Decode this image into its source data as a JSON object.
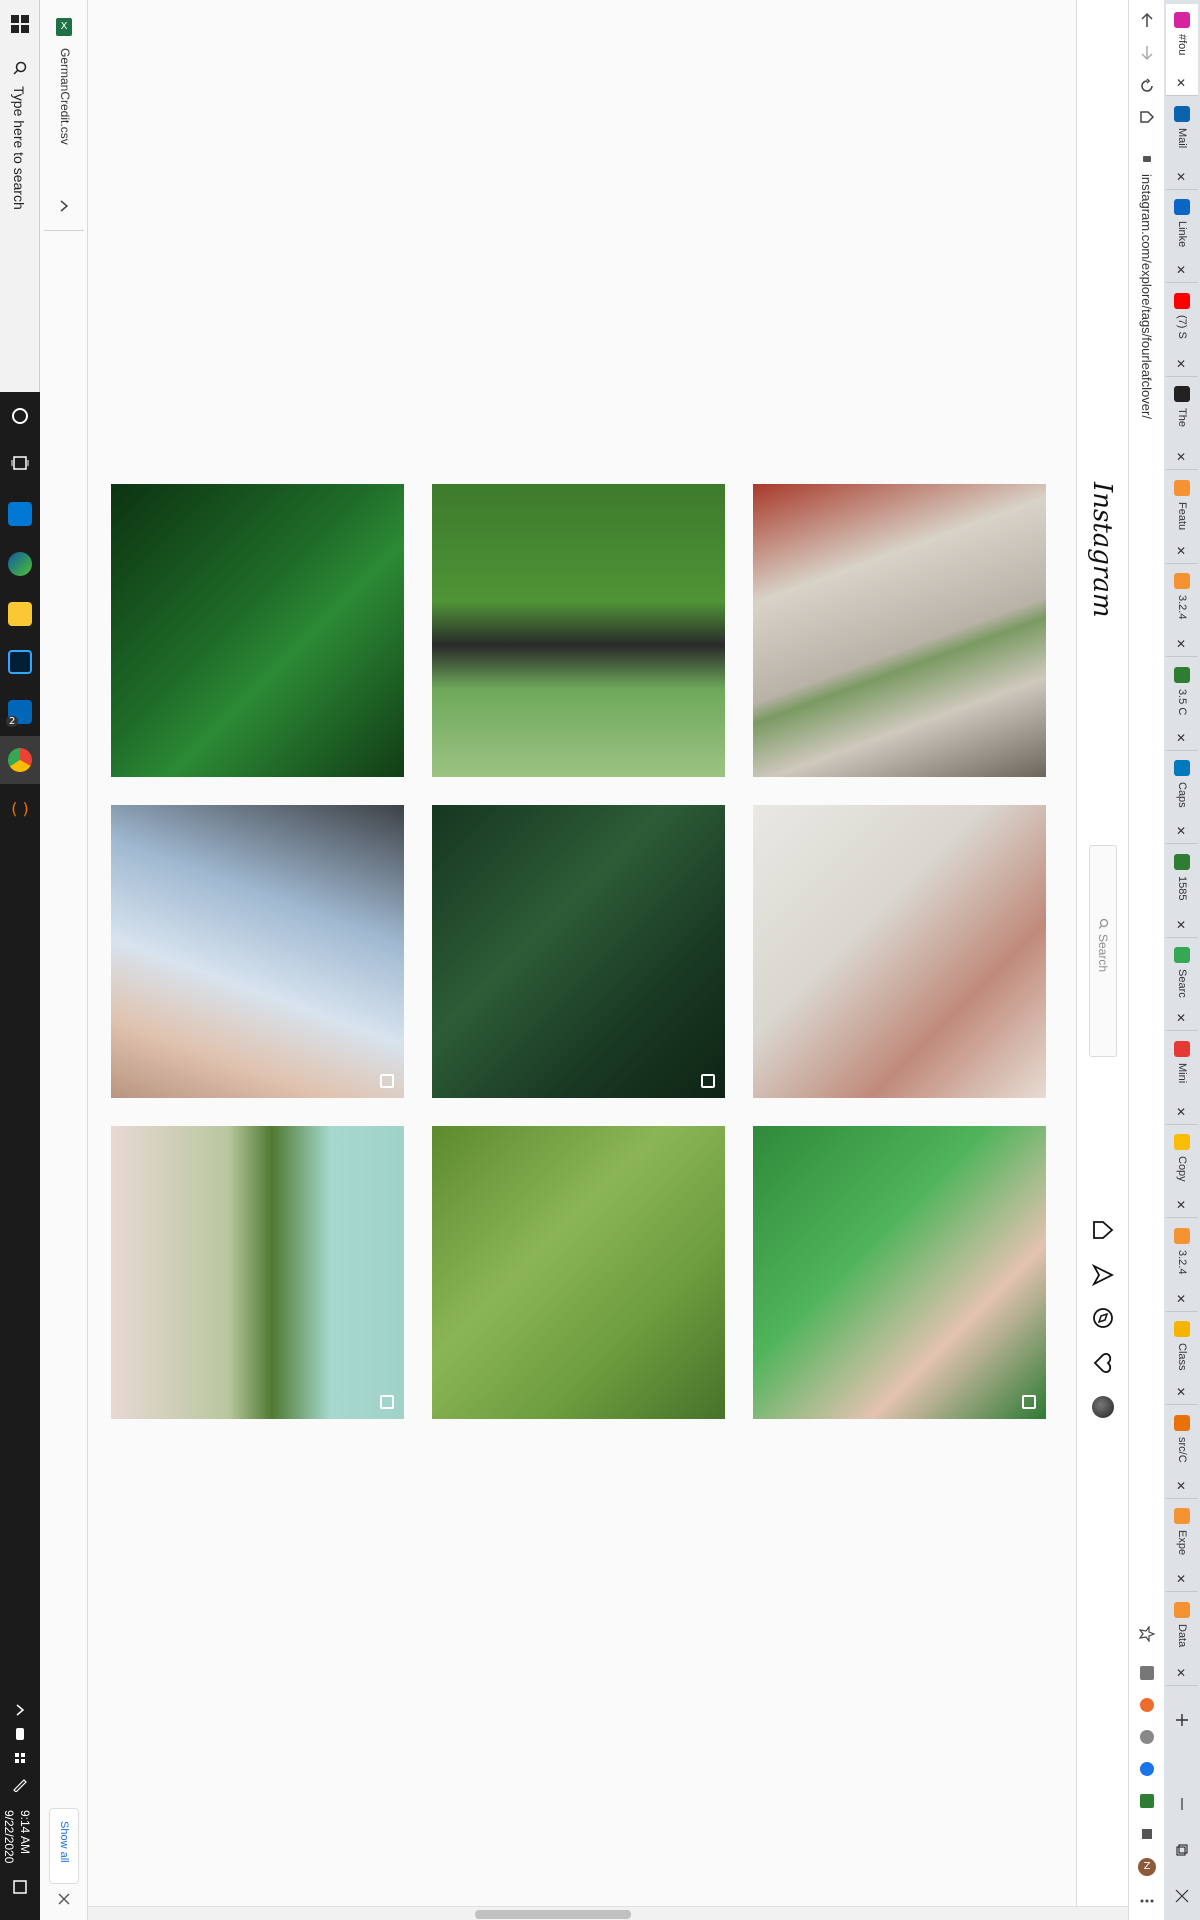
{
  "taskbar": {
    "search_placeholder": "Type here to search",
    "clock_time": "9:14 AM",
    "clock_date": "9/22/2020",
    "badge_count": "2"
  },
  "downloads": {
    "file_name": "GermanCredit.csv",
    "show_all": "Show all",
    "file_icon": "X"
  },
  "browser": {
    "url": "instagram.com/explore/tags/fourleafclover/",
    "tabs": [
      {
        "label": "#fou",
        "icon": "instagram-icon",
        "color": "#d6249f",
        "active": true
      },
      {
        "label": "Mail",
        "icon": "outlook-icon",
        "color": "#0a64ad"
      },
      {
        "label": "Linke",
        "icon": "linkedin-icon",
        "color": "#0a66c2"
      },
      {
        "label": "(7) S",
        "icon": "youtube-icon",
        "color": "#ff0000"
      },
      {
        "label": "The",
        "icon": "threads-icon",
        "color": "#222222"
      },
      {
        "label": "Featu",
        "icon": "jira-icon",
        "color": "#f79232"
      },
      {
        "label": "3.2.4",
        "icon": "jira-icon",
        "color": "#f79232"
      },
      {
        "label": "3.5 C",
        "icon": "course-icon",
        "color": "#2e7d32"
      },
      {
        "label": "Caps",
        "icon": "board-icon",
        "color": "#0079bf"
      },
      {
        "label": "1585",
        "icon": "course-icon",
        "color": "#2e7d32"
      },
      {
        "label": "Searc",
        "icon": "drive-icon",
        "color": "#34a853"
      },
      {
        "label": "Mini",
        "icon": "app-icon",
        "color": "#e53935"
      },
      {
        "label": "Copy",
        "icon": "app-icon",
        "color": "#fbbc04"
      },
      {
        "label": "3.2.4",
        "icon": "jira-icon",
        "color": "#f79232"
      },
      {
        "label": "Class",
        "icon": "notes-icon",
        "color": "#f4b400"
      },
      {
        "label": "src/C",
        "icon": "code-icon",
        "color": "#e8710a"
      },
      {
        "label": "Expe",
        "icon": "jira-icon",
        "color": "#f79232"
      },
      {
        "label": "Data",
        "icon": "jira-icon",
        "color": "#f79232"
      }
    ]
  },
  "instagram": {
    "logo": "Instagram",
    "search_placeholder": "Search"
  },
  "grid": {
    "tiles": [
      {
        "name": "clover-field",
        "bg": "linear-gradient(135deg,#0d3311 0%,#1f6d29 45%,#2c8a35 60%,#123d16 100%)"
      },
      {
        "name": "black-dog-in-grass",
        "bg": "linear-gradient(180deg,#3d7a2c 0%,#4f9436 40%,#2a2a2a 55%,#6da85a 70%,#9cc383 100%)"
      },
      {
        "name": "clover-pendant",
        "bg": "linear-gradient(160deg,#a83a2a 0%,#d8d2c7 30%,#b9b2a7 55%,#7a9a62 60%,#cfc8bd 75%,#6d665d 100%)"
      },
      {
        "name": "hand-clover-sky",
        "bg": "linear-gradient(200deg,#3e4247 0%,#9fb8d0 35%,#d7e3ee 60%,#e0c3b0 80%,#b89580 100%)",
        "badge": true
      },
      {
        "name": "dewy-leaves",
        "bg": "linear-gradient(135deg,#163620 0%,#2d5c37 40%,#1a3a24 70%,#0e2415 100%)",
        "badge": true
      },
      {
        "name": "four-leaf-fingers",
        "bg": "linear-gradient(135deg,#eae8e3 0%,#d9d6cf 40%,#c08a7a 70%,#e6dcd3 100%)"
      },
      {
        "name": "maybe-nope-illustration",
        "bg": "linear-gradient(90deg,#e8d8d4 0%,#b9c79e 40%,#4f7a32 55%,#a7d8cf 75%,#9fd2c8 100%)",
        "badge": true
      },
      {
        "name": "clover-grass",
        "bg": "linear-gradient(135deg,#5e8a2f 0%,#8bb556 40%,#6c9c3e 70%,#47722a 100%)"
      },
      {
        "name": "hand-in-clover",
        "bg": "linear-gradient(135deg,#2f8a3a 0%,#4fb45a 40%,#e3c2b0 70%,#2d7a34 100%)",
        "badge": true
      }
    ]
  }
}
